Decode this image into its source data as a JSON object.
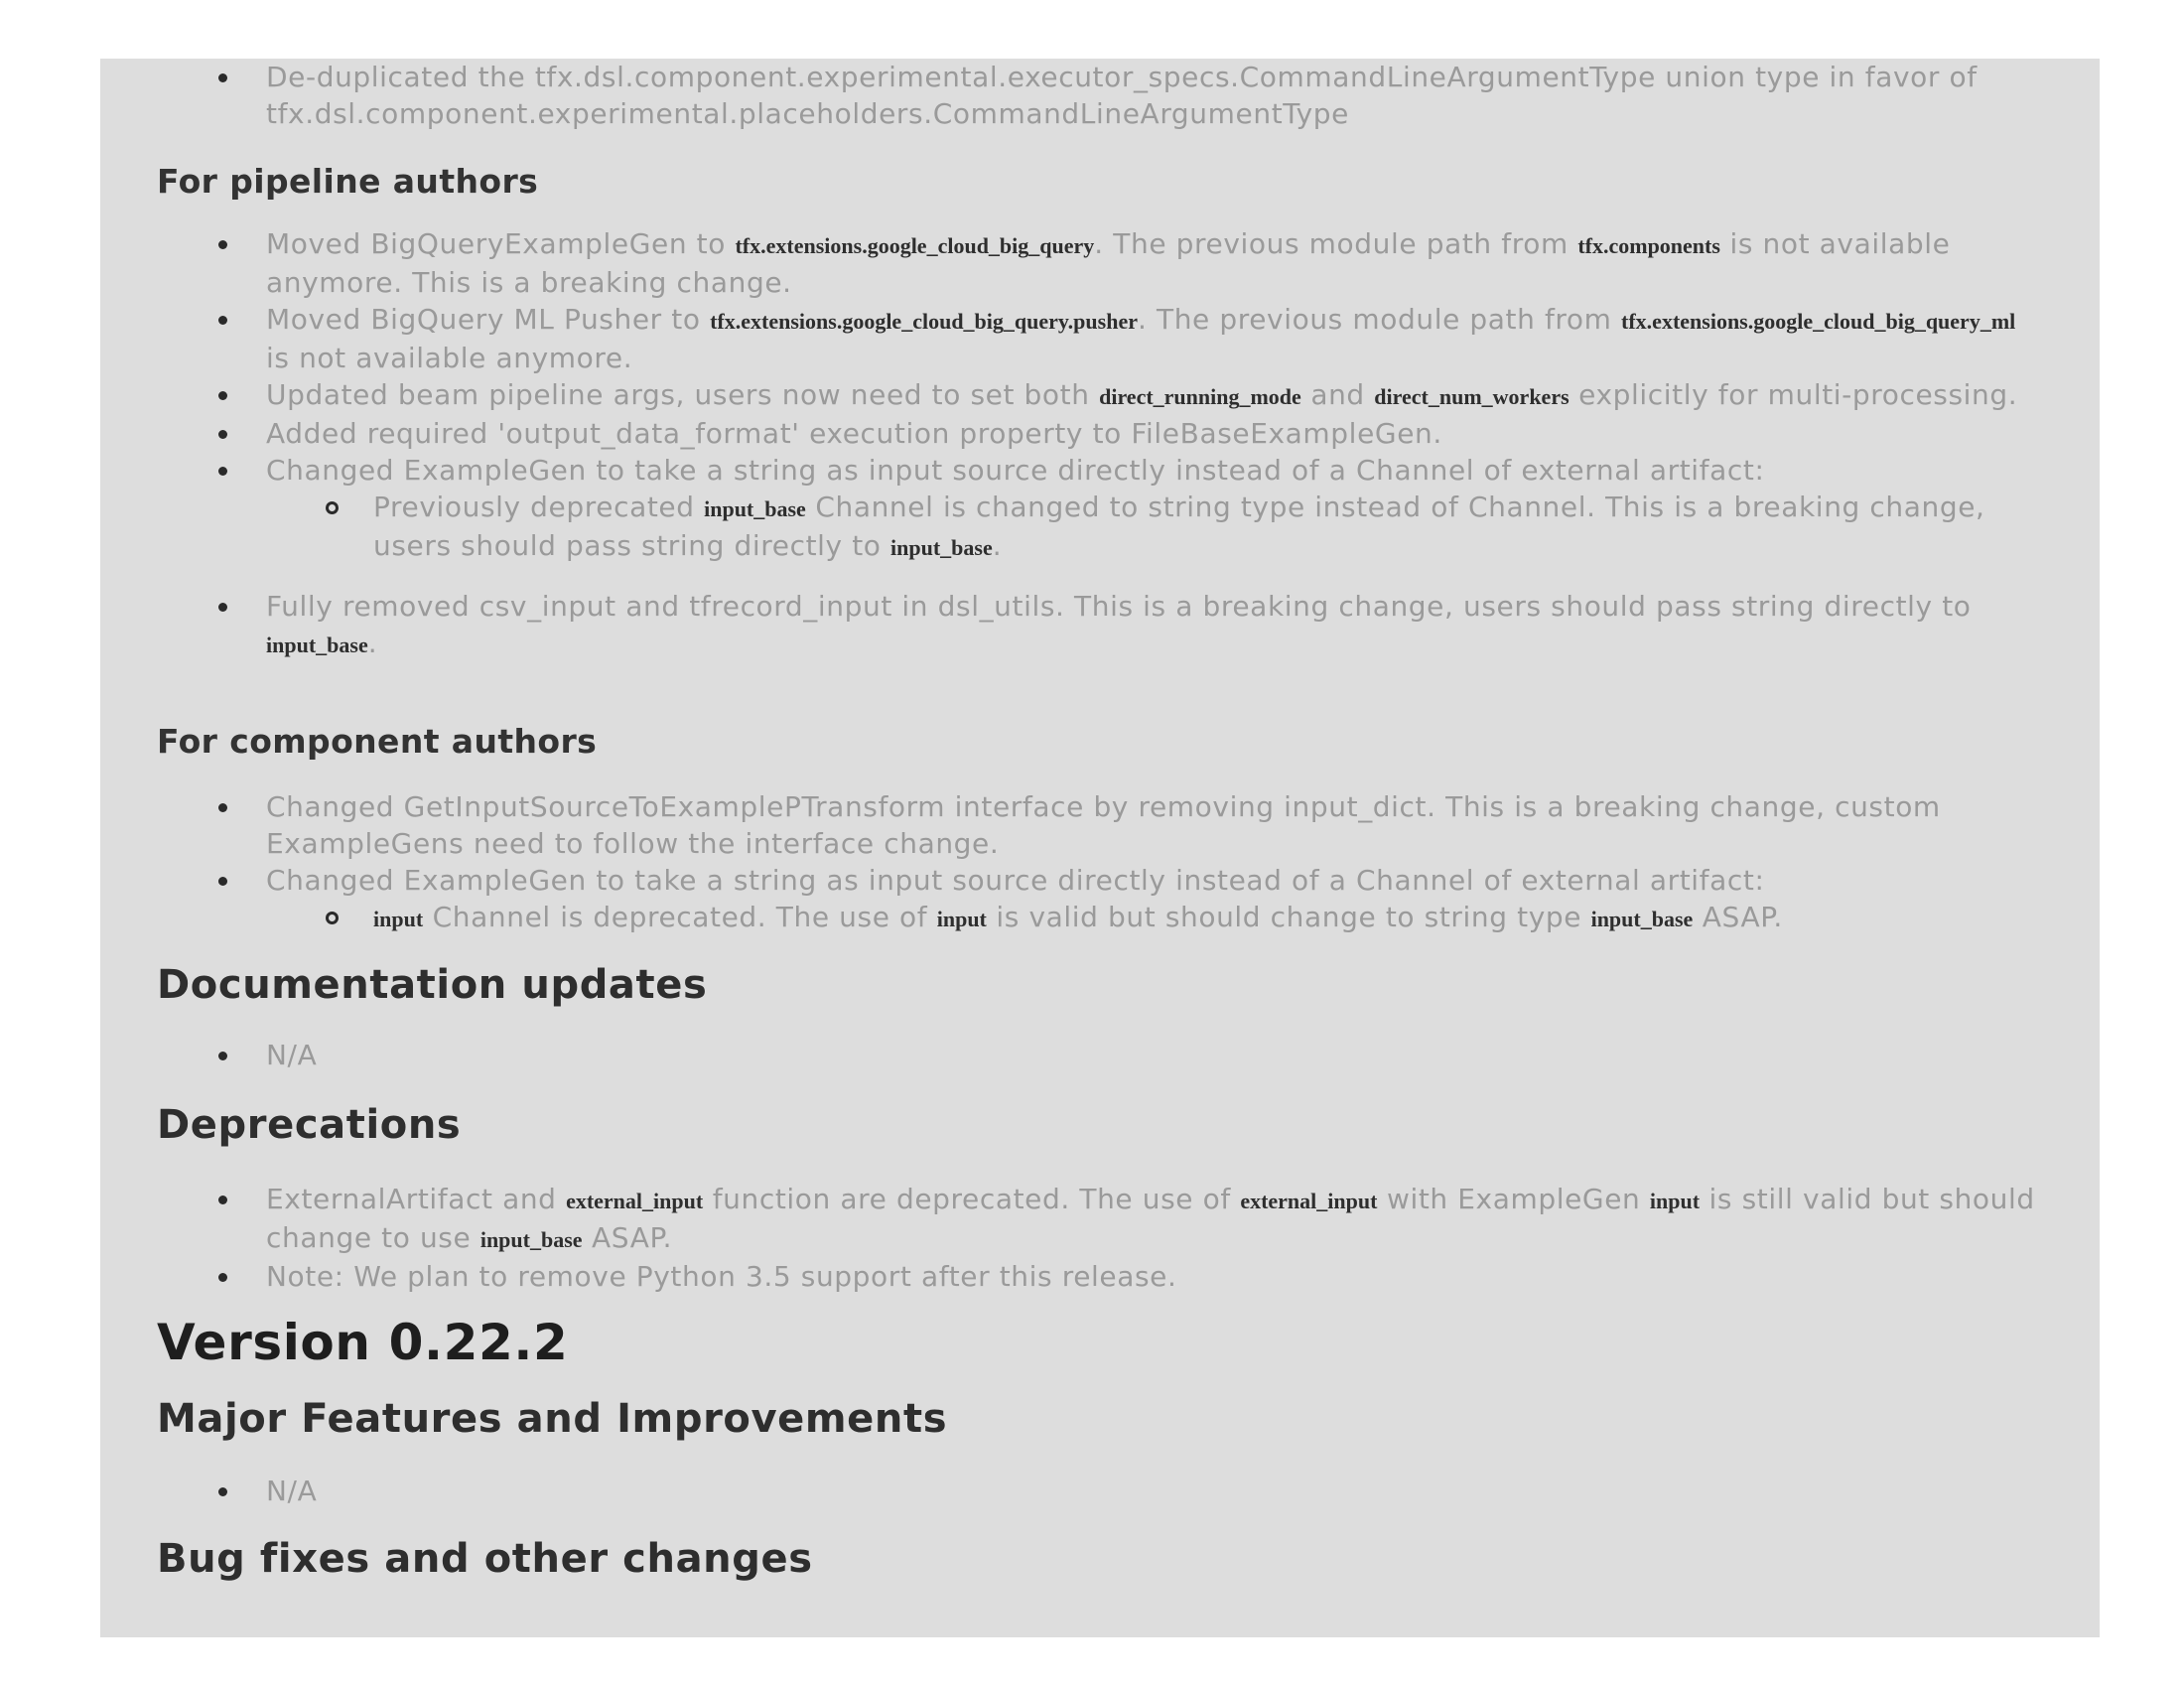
{
  "intro": {
    "item1": "De-duplicated the tfx.dsl.component.experimental.executor_specs.CommandLineArgumentType union type in favor of tfx.dsl.component.experimental.placeholders.CommandLineArgumentType"
  },
  "pipeline_authors": {
    "heading": "For pipeline authors",
    "i1": {
      "t1": "Moved BigQueryExampleGen to ",
      "c1": "tfx.extensions.google_cloud_big_query",
      "t2": ". The previous module path from ",
      "c2": "tfx.components",
      "t3": " is not available anymore. This is a breaking change."
    },
    "i2": {
      "t1": "Moved BigQuery ML Pusher to ",
      "c1": "tfx.extensions.google_cloud_big_query.pusher",
      "t2": ". The previous module path from ",
      "c2": "tfx.extensions.google_cloud_big_query_ml",
      "t3": " is not available anymore."
    },
    "i3": {
      "t1": "Updated beam pipeline args, users now need to set both ",
      "c1": "direct_running_mode",
      "t2": " and ",
      "c2": "direct_num_workers",
      "t3": " explicitly for multi-processing."
    },
    "i4": "Added required 'output_data_format' execution property to FileBaseExampleGen.",
    "i5": "Changed ExampleGen to take a string as input source directly instead of a Channel of external artifact:",
    "i5a": {
      "t1": "Previously deprecated ",
      "c1": "input_base",
      "t2": " Channel is changed to string type instead of Channel. This is a breaking change, users should pass string directly to ",
      "c2": "input_base",
      "t3": "."
    },
    "i6": {
      "t1": "Fully removed csv_input and tfrecord_input in dsl_utils. This is a breaking change, users should pass string directly to ",
      "c1": "input_base",
      "t2": "."
    }
  },
  "component_authors": {
    "heading": "For component authors",
    "i1": "Changed GetInputSourceToExamplePTransform interface by removing input_dict. This is a breaking change, custom ExampleGens need to follow the interface change.",
    "i2": "Changed ExampleGen to take a string as input source directly instead of a Channel of external artifact:",
    "i2a": {
      "c1": "input",
      "t1": " Channel is deprecated. The use of ",
      "c2": "input",
      "t2": " is valid but should change to string type ",
      "c3": "input_base",
      "t3": " ASAP."
    }
  },
  "documentation": {
    "heading": "Documentation updates",
    "i1": "N/A"
  },
  "deprecations": {
    "heading": "Deprecations",
    "i1": {
      "t1": "ExternalArtifact and ",
      "c1": "external_input",
      "t2": " function are deprecated. The use of ",
      "c2": "external_input",
      "t3": " with ExampleGen ",
      "c3": "input",
      "t4": " is still valid but should change to use ",
      "c4": "input_base",
      "t5": " ASAP."
    },
    "i2": "Note: We plan to remove Python 3.5 support after this release."
  },
  "version": {
    "title": "Version 0.22.2",
    "major_heading": "Major Features and Improvements",
    "major_i1": "N/A",
    "bugfix_heading": "Bug fixes and other changes"
  }
}
